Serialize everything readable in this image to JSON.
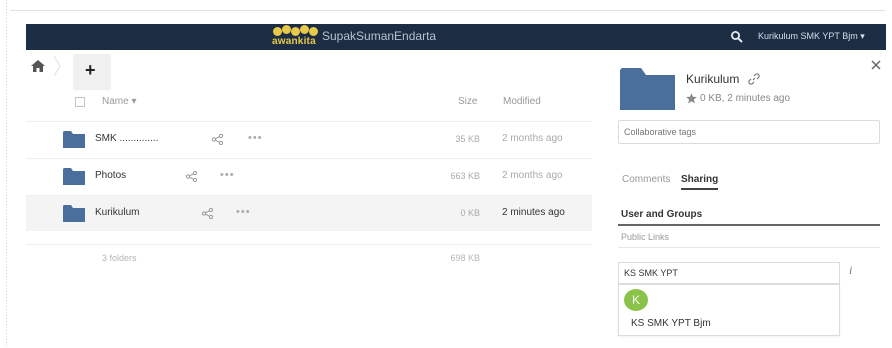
{
  "header": {
    "logo_text": "awankita",
    "app_title": "SupakSumanEndarta",
    "user_name": "Kurikulum SMK YPT Bjm",
    "user_dropdown": "▾",
    "colors": {
      "bar": "#1d2d44",
      "logo": "#e8c94a"
    }
  },
  "toolbar": {
    "new_label": "+"
  },
  "file_list": {
    "columns": {
      "name": "Name ▾",
      "size": "Size",
      "modified": "Modified"
    },
    "rows": [
      {
        "name": "SMK ..............",
        "size": "35 KB",
        "modified": "2 months ago",
        "selected": false
      },
      {
        "name": "Photos",
        "size": "663 KB",
        "modified": "2 months ago",
        "selected": false
      },
      {
        "name": "Kurikulum",
        "size": "0 KB",
        "modified": "2 minutes ago",
        "selected": true
      }
    ],
    "more_label": "•••",
    "summary": {
      "count": "3 folders",
      "size": "698 KB"
    },
    "folder_color": "#4a6f9c"
  },
  "sidebar": {
    "title": "Kurikulum",
    "meta": "0 KB, 2 minutes ago",
    "tags_placeholder": "Collaborative tags",
    "tabs": {
      "comments": "Comments",
      "sharing": "Sharing"
    },
    "subtabs": {
      "users_groups": "User and Groups",
      "public_links": "Public Links"
    },
    "share_input_value": "KS SMK YPT",
    "info_glyph": "i",
    "suggestion": {
      "avatar_letter": "K",
      "name": "KS SMK YPT Bjm",
      "avatar_color": "#8bc34a"
    }
  }
}
